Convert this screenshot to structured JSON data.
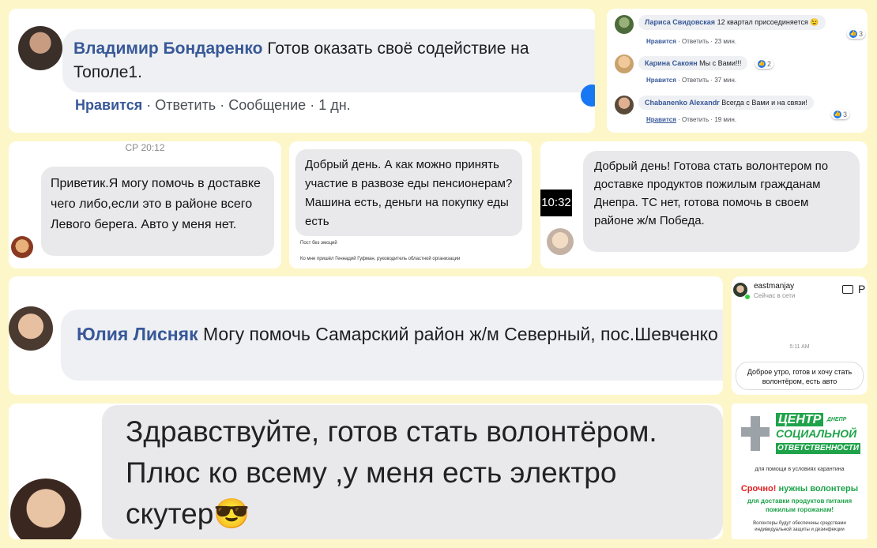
{
  "p1": {
    "name": "Владимир Бондаренко",
    "text": "Готов оказать своё содействие на Тополе1.",
    "like": "Нравится",
    "reply": "Ответить",
    "message": "Сообщение",
    "time": "1 дн."
  },
  "p2": {
    "comments": [
      {
        "name": "Лариса Свидовская",
        "text": "12 квартал присоединяется 😉",
        "like": "Нравится",
        "reply": "Ответить",
        "time": "23 мин.",
        "reactions": "3"
      },
      {
        "name": "Карина Сакоян",
        "text": "Мы с Вами!!!",
        "like": "Нравится",
        "reply": "Ответить",
        "time": "37 мин.",
        "reactions": "2"
      },
      {
        "name": "Chabanenko Alexandr",
        "text": "Всегда с Вами и на связи!",
        "like": "Нравится",
        "reply": "Ответить",
        "time": "19 мин.",
        "reactions": "3"
      }
    ]
  },
  "p3": {
    "timestamp": "СР 20:12",
    "text": "Приветик.Я могу помочь в доставке чего либо,если это в районе всего Левого берега. Авто у меня нет."
  },
  "p4": {
    "text": "Добрый день. А как можно принять участие в развозе еды пенсионерам? Машина есть, деньги на покупку еды есть",
    "small1": "Пост без эмоций",
    "small2": "Ко мне пришёл Геннадий Гуфман, руководитель областной организации"
  },
  "p5": {
    "time": "10:32",
    "text": "Добрый день! Готова стать волонтером по доставке продуктов пожилым гражданам Днепра. ТС нет, готова помочь в своем районе ж/м Победа."
  },
  "p6": {
    "name": "Юлия Лисняк",
    "text": "Могу помочь Самарский район ж/м Северный, пос.Шевченко"
  },
  "p7": {
    "username": "eastmanjay",
    "status": "Сейчас в сети",
    "time": "5:11 AM",
    "text": "Доброе утро, готов и хочу стать волонтёром, есть авто"
  },
  "p8": {
    "text": "Здравствуйте, готов стать волонтёром. Плюс ко всему ,у меня есть электро скутер😎"
  },
  "p9": {
    "logo_line1": "ЦЕНТР",
    "logo_tag": "ДНЕПР",
    "logo_line2": "СОЦИАЛЬНОЙ",
    "logo_line3": "ОТВЕТСТВЕННОСТИ",
    "sub": "для помощи в условиях карантина",
    "urgent_red": "Срочно!",
    "urgent_green": "нужны волонтеры",
    "line2": "для доставки продуктов питания",
    "line3": "пожилым горожанам!",
    "footer": "Волонтеры будут обеспечены средствами индивидуальной защиты и дезинфекции"
  },
  "colors": {
    "background": "#fdf6c8",
    "fb_link": "#385898",
    "brand_green": "#1fa34a",
    "urgent_red": "#e02020"
  }
}
